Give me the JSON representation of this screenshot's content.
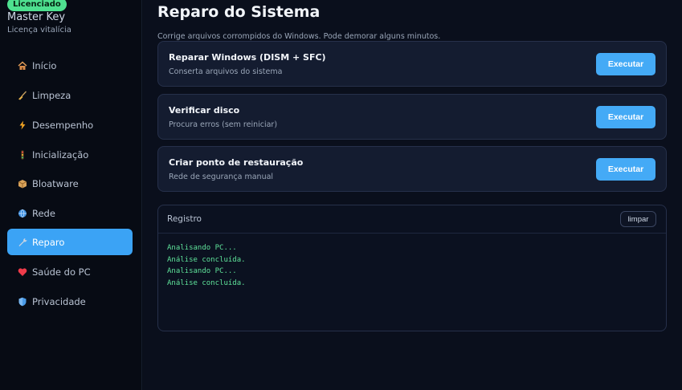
{
  "sidebar": {
    "badge": "Licenciado",
    "brand_title": "Master Key",
    "brand_sub": "Licença vitalícia",
    "items": [
      {
        "label": "Início",
        "icon": "house-icon"
      },
      {
        "label": "Limpeza",
        "icon": "broom-icon"
      },
      {
        "label": "Desempenho",
        "icon": "lightning-icon"
      },
      {
        "label": "Inicialização",
        "icon": "traffic-light-icon"
      },
      {
        "label": "Bloatware",
        "icon": "package-icon"
      },
      {
        "label": "Rede",
        "icon": "globe-icon"
      },
      {
        "label": "Reparo",
        "icon": "wrench-icon",
        "active": true
      },
      {
        "label": "Saúde do PC",
        "icon": "heart-icon"
      },
      {
        "label": "Privacidade",
        "icon": "shield-icon"
      }
    ]
  },
  "main": {
    "title": "Reparo do Sistema",
    "description": "Corrige arquivos corrompidos do Windows. Pode demorar alguns minutos.",
    "cards": [
      {
        "title": "Reparar Windows (DISM + SFC)",
        "subtitle": "Conserta arquivos do sistema",
        "button": "Executar"
      },
      {
        "title": "Verificar disco",
        "subtitle": "Procura erros (sem reiniciar)",
        "button": "Executar"
      },
      {
        "title": "Criar ponto de restauração",
        "subtitle": "Rede de segurança manual",
        "button": "Executar"
      }
    ],
    "log": {
      "title": "Registro",
      "clear_label": "limpar",
      "lines": [
        "Analisando PC...",
        "Análise concluída.",
        "Analisando PC...",
        "Análise concluída."
      ]
    }
  },
  "colors": {
    "accent": "#3ba3f5",
    "badge": "#4ee08f",
    "log_text": "#5fe39a",
    "background": "#0a0f1c"
  }
}
